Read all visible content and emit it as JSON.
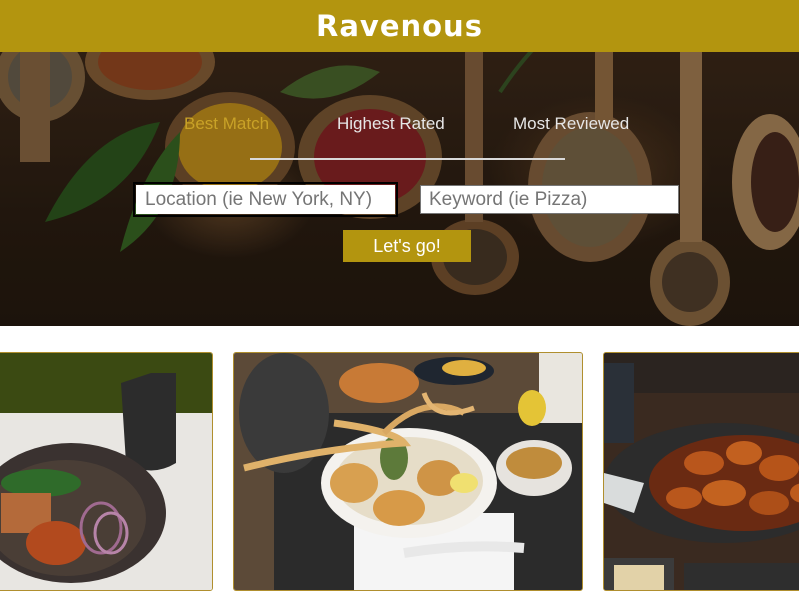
{
  "header": {
    "title": "Ravenous"
  },
  "sort_options": [
    {
      "label": "Best Match",
      "active": true
    },
    {
      "label": "Highest Rated",
      "active": false
    },
    {
      "label": "Most Reviewed",
      "active": false
    }
  ],
  "search": {
    "location_placeholder": "Location (ie New York, NY)",
    "location_value": "",
    "keyword_placeholder": "Keyword (ie Pizza)",
    "keyword_value": "",
    "submit_label": "Let's go!"
  },
  "colors": {
    "brand": "#b3950f",
    "active_sort": "#c9a227",
    "card_border": "#b08f2e"
  },
  "businesses": [
    {
      "image": "food-photo-noodle-bowl"
    },
    {
      "image": "food-photo-tempura-ramen"
    },
    {
      "image": "food-photo-glazed-chicken"
    }
  ]
}
